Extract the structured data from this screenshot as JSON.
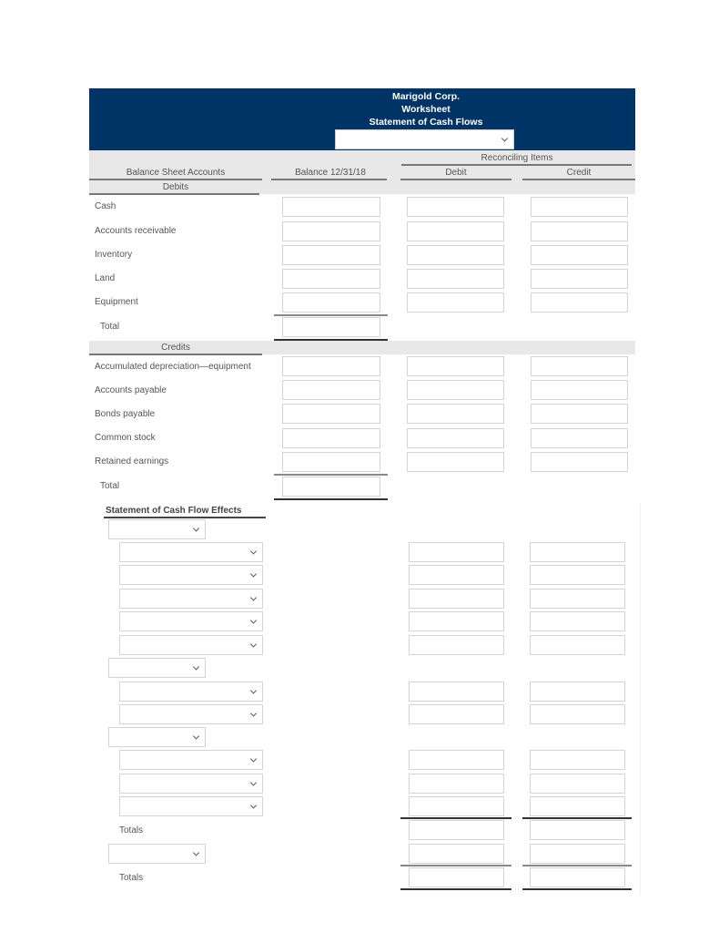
{
  "header": {
    "company": "Marigold Corp.",
    "title": "Worksheet",
    "subtitle": "Statement of Cash Flows",
    "period_select_value": ""
  },
  "columns": {
    "accounts": "Balance Sheet Accounts",
    "balance": "Balance 12/31/18",
    "reconciling": "Reconciling Items",
    "debit": "Debit",
    "credit": "Credit"
  },
  "debits": {
    "heading": "Debits",
    "rows": [
      "Cash",
      "Accounts receivable",
      "Inventory",
      "Land",
      "Equipment"
    ],
    "total_label": "Total"
  },
  "credits": {
    "heading": "Credits",
    "rows": [
      "Accumulated depreciation—equipment",
      "Accounts payable",
      "Bonds payable",
      "Common stock",
      "Retained earnings"
    ],
    "total_label": "Total"
  },
  "cash_flow_effects": {
    "heading": "Statement of Cash Flow Effects",
    "section_selects": [
      "",
      "",
      "",
      ""
    ],
    "item_selects": [
      "",
      "",
      "",
      "",
      "",
      "",
      "",
      "",
      "",
      ""
    ],
    "totals_label": "Totals",
    "final_totals_label": "Totals"
  }
}
